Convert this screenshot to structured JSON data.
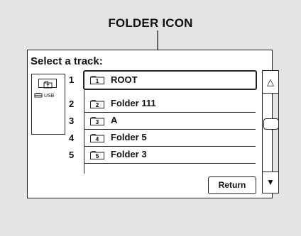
{
  "callout": {
    "label": "FOLDER ICON"
  },
  "screen": {
    "title": "Select a track:",
    "side_panel": {
      "up_icon": "folder-up-icon",
      "usb_icon": "usb-device-icon",
      "usb_label": "USB"
    },
    "items": [
      {
        "number": "1",
        "folder_number": "1",
        "label": "ROOT",
        "selected": true
      },
      {
        "number": "2",
        "folder_number": "2",
        "label": "Folder 111",
        "selected": false
      },
      {
        "number": "3",
        "folder_number": "3",
        "label": "A",
        "selected": false
      },
      {
        "number": "4",
        "folder_number": "4",
        "label": "Folder 5",
        "selected": false
      },
      {
        "number": "5",
        "folder_number": "5",
        "label": "Folder 3",
        "selected": false
      }
    ],
    "return_label": "Return",
    "scroll": {
      "up_symbol": "△",
      "down_symbol": "▼"
    }
  }
}
